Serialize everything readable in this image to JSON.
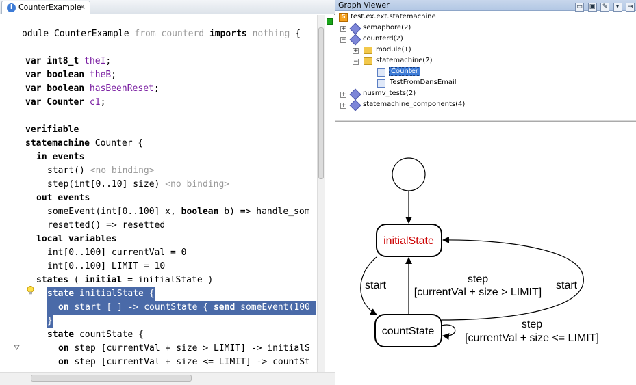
{
  "editor": {
    "tab_label": "CounterExample",
    "tab_icon": "info-icon",
    "tab_close": "✕"
  },
  "code": {
    "l01a": "odule CounterExample ",
    "l01b": "from counterd",
    "l01c": " imports ",
    "l01d": "nothing",
    "l01e": " {",
    "l03a": "var int8_t ",
    "l03b": "theI",
    "l03c": ";",
    "l04a": "var boolean ",
    "l04b": "theB",
    "l04c": ";",
    "l05a": "var boolean ",
    "l05b": "hasBeenReset",
    "l05c": ";",
    "l06a": "var Counter ",
    "l06b": "c1",
    "l06c": ";",
    "l08": "verifiable",
    "l09a": "statemachine",
    "l09b": " Counter {",
    "l10": "in events",
    "l11a": "start() ",
    "l11b": "<no binding>",
    "l12a": "step(int[0..10] size) ",
    "l12b": "<no binding>",
    "l13": "out events",
    "l14a": "someEvent(int[0..100] x, ",
    "l14b": "boolean",
    "l14c": " b) => handle_som",
    "l15": "resetted() => resetted",
    "l16": "local variables",
    "l17": "int[0..100] currentVal = 0",
    "l18": "int[0..100] LIMIT = 10",
    "l19a": "states",
    "l19b": " ( ",
    "l19c": "initial",
    "l19d": " = initialState )",
    "l20a": "state",
    "l20b": " initialState {",
    "l21a": "on",
    "l21b": " start [ ] -> countState { ",
    "l21c": "send",
    "l21d": " someEvent(100",
    "l22": "}",
    "l23a": "state",
    "l23b": " countState {",
    "l24a": "on",
    "l24b": " step [currentVal + size > LIMIT] -> initialS",
    "l25a": "on",
    "l25b": " step [currentVal + size <= LIMIT] -> countSt",
    "l26": "                 "
  },
  "graph_viewer": {
    "title": "Graph Viewer",
    "buttons": [
      "▭",
      "▣",
      "✎",
      "▾",
      "⇥"
    ],
    "tree": {
      "root": "test.ex.ext.statemachine",
      "semaphore": "semaphore(2)",
      "counterd": "counterd(2)",
      "module": "module(1)",
      "statemachine": "statemachine(2)",
      "counter": "Counter",
      "testfrom": "TestFromDansEmail",
      "nusmv": "nusmv_tests(2)",
      "components": "statemachine_components(4)"
    }
  },
  "graph": {
    "initial_state": "initialState",
    "count_state": "countState",
    "edge_start_1": "start",
    "edge_start_2": "start",
    "edge_step_1": "step",
    "edge_guard_1": "[currentVal + size > LIMIT]",
    "edge_step_2": "step",
    "edge_guard_2": "[currentVal + size <= LIMIT]",
    "initial_color": "#cc0000"
  }
}
